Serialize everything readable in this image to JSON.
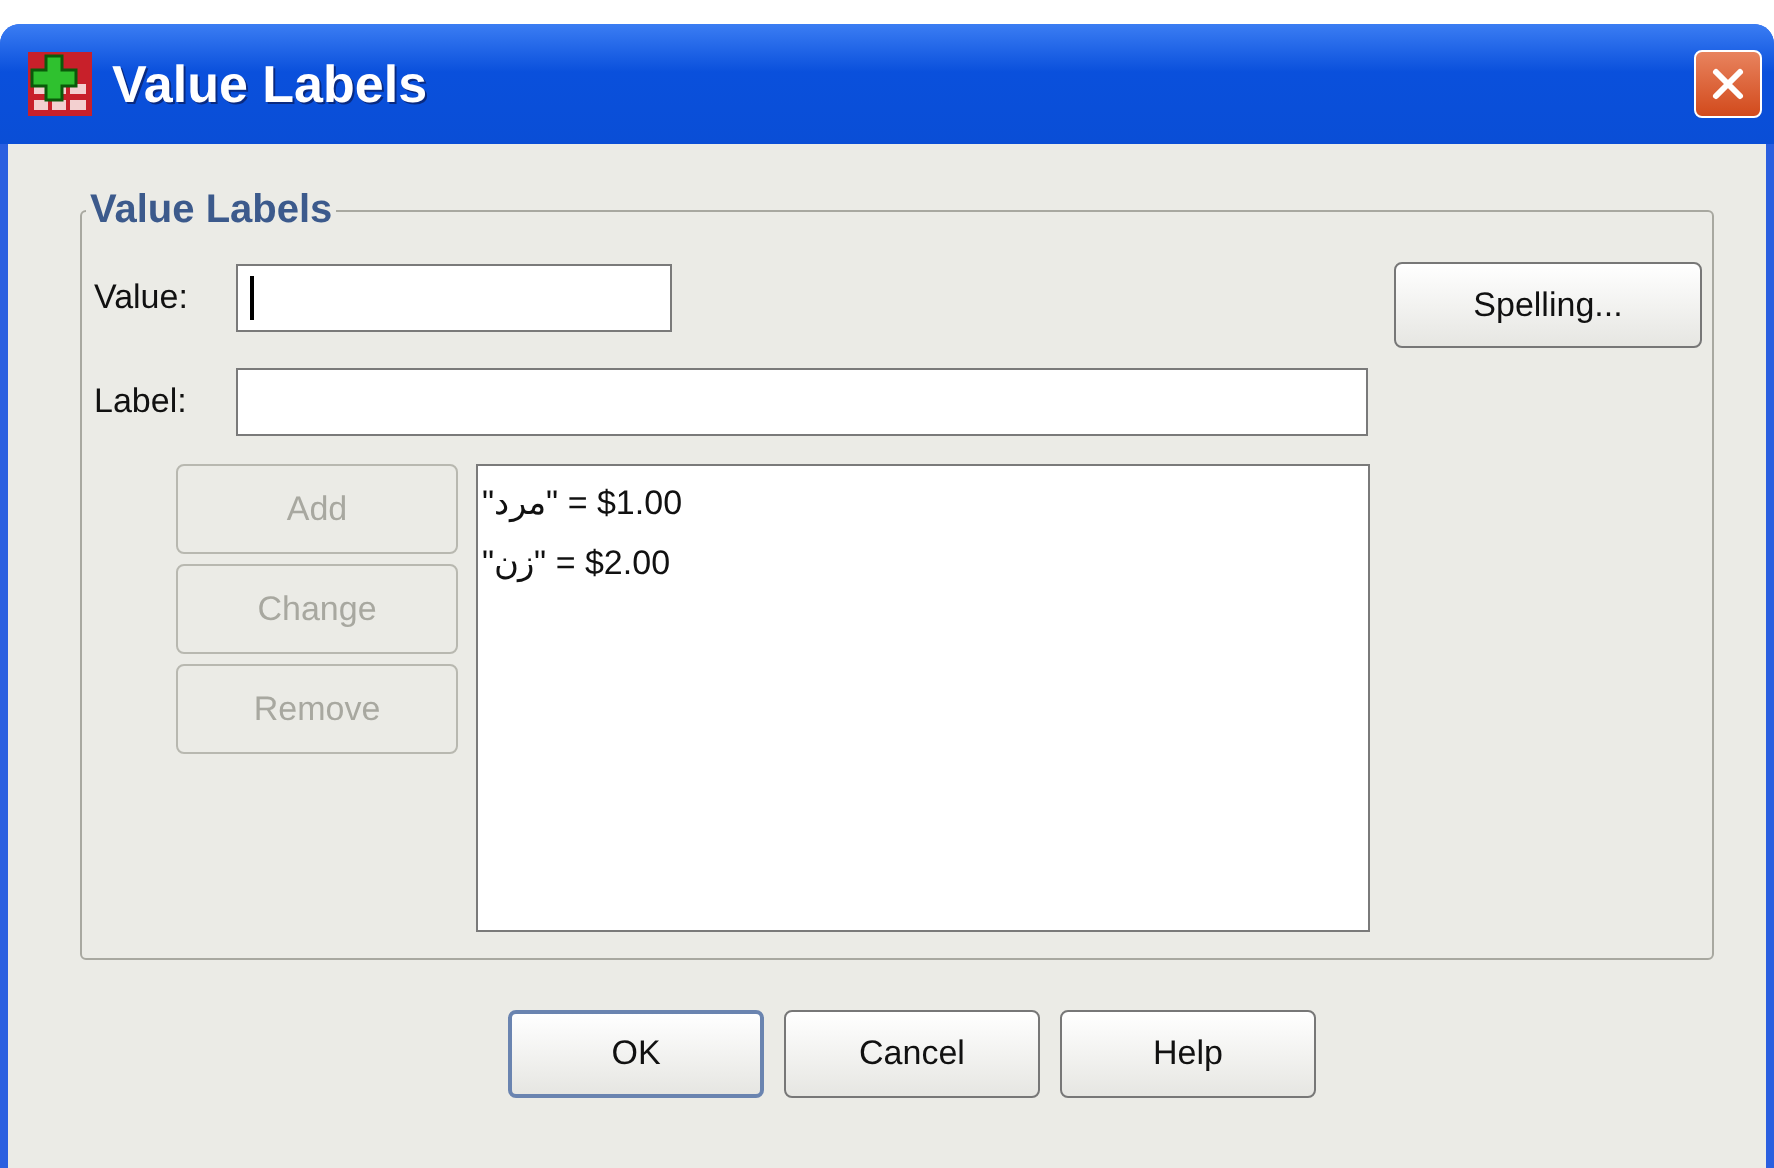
{
  "window": {
    "title": "Value Labels"
  },
  "group": {
    "title": "Value Labels"
  },
  "value_field": {
    "label": "Value:",
    "focused": true
  },
  "label_field": {
    "label": "Label:"
  },
  "side_buttons": [
    {
      "label": "Add",
      "disabled": true
    },
    {
      "label": "Change",
      "disabled": true
    },
    {
      "label": "Remove",
      "disabled": true
    }
  ],
  "spelling_button": {
    "label": "Spelling..."
  },
  "labels_list": [
    {
      "label": "\"مرد\"",
      "value": "= $1.00"
    },
    {
      "label": "\"زن\"",
      "value": "= $2.00"
    }
  ],
  "buttons": [
    {
      "label": "OK",
      "default": true
    },
    {
      "label": "Cancel",
      "default": false
    },
    {
      "label": "Help",
      "default": false
    }
  ]
}
